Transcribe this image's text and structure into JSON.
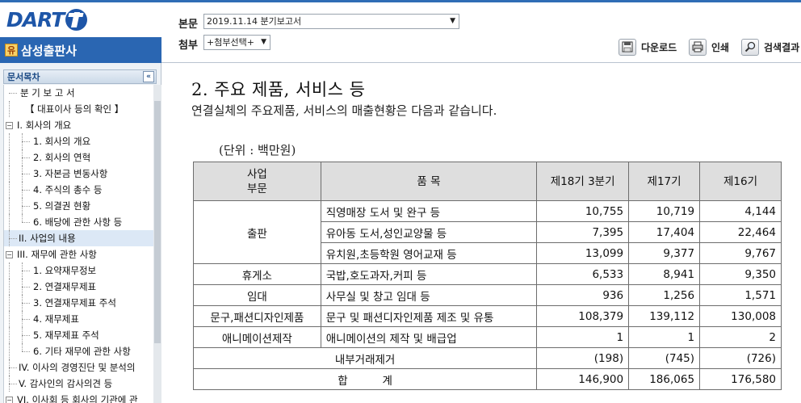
{
  "header": {
    "logo_text": "DART",
    "company_badge": "유",
    "company_name": "삼성출판사",
    "doc_label": "본문",
    "doc_select_value": "2019.11.14   분기보고서",
    "attach_label": "첨부",
    "attach_select_value": "+첨부선택+",
    "buttons": {
      "download": "다운로드",
      "print": "인쇄",
      "search": "검색결과"
    }
  },
  "sidebar": {
    "title": "문서목차",
    "collapse_glyph": "«",
    "items": [
      {
        "label": "분 기 보 고 서"
      },
      {
        "label": "【 대표이사 등의 확인 】"
      },
      {
        "label": "I. 회사의 개요"
      },
      {
        "label": "1. 회사의 개요"
      },
      {
        "label": "2. 회사의 연혁"
      },
      {
        "label": "3. 자본금 변동사항"
      },
      {
        "label": "4. 주식의 총수 등"
      },
      {
        "label": "5. 의결권 현황"
      },
      {
        "label": "6. 배당에 관한 사항 등"
      },
      {
        "label": "II. 사업의 내용"
      },
      {
        "label": "III. 재무에 관한 사항"
      },
      {
        "label": "1. 요약재무정보"
      },
      {
        "label": "2. 연결재무제표"
      },
      {
        "label": "3. 연결재무제표 주석"
      },
      {
        "label": "4. 재무제표"
      },
      {
        "label": "5. 재무제표 주석"
      },
      {
        "label": "6. 기타 재무에 관한 사항"
      },
      {
        "label": "IV. 이사의 경영진단 및 분석의"
      },
      {
        "label": "V. 감사인의 감사의견 등"
      },
      {
        "label": "VI. 이사회 등 회사의 기관에 관"
      }
    ]
  },
  "content": {
    "title": "2. 주요 제품, 서비스 등",
    "intro": "연결실체의 주요제품, 서비스의 매출현황은 다음과 같습니다.",
    "unit": "(단위 : 백만원)",
    "table": {
      "headers": {
        "segment_line1": "사업",
        "segment_line2": "부문",
        "product": "품 목",
        "col1": "제18기 3분기",
        "col2": "제17기",
        "col3": "제16기"
      },
      "rows": [
        {
          "segment": "출판",
          "product": "직영매장 도서 및 완구 등",
          "v1": "10,755",
          "v2": "10,719",
          "v3": "4,144"
        },
        {
          "segment": "",
          "product": "유아동 도서,성인교양물 등",
          "v1": "7,395",
          "v2": "17,404",
          "v3": "22,464"
        },
        {
          "segment": "",
          "product": "유치원,초등학원 영어교재 등",
          "v1": "13,099",
          "v2": "9,377",
          "v3": "9,767"
        },
        {
          "segment": "휴게소",
          "product": "국밥,호도과자,커피 등",
          "v1": "6,533",
          "v2": "8,941",
          "v3": "9,350"
        },
        {
          "segment": "임대",
          "product": "사무실 및 창고 임대 등",
          "v1": "936",
          "v2": "1,256",
          "v3": "1,571"
        },
        {
          "segment": "문구,패션디자인제품",
          "product": "문구 및 패션디자인제품 제조 및 유통",
          "v1": "108,379",
          "v2": "139,112",
          "v3": "130,008"
        },
        {
          "segment": "애니메이션제작",
          "product": "애니메이션의 제작 및 배급업",
          "v1": "1",
          "v2": "1",
          "v3": "2"
        }
      ],
      "elim": {
        "label": "내부거래제거",
        "v1": "(198)",
        "v2": "(745)",
        "v3": "(726)"
      },
      "total": {
        "label": "합          계",
        "v1": "146,900",
        "v2": "186,065",
        "v3": "176,580"
      }
    }
  }
}
